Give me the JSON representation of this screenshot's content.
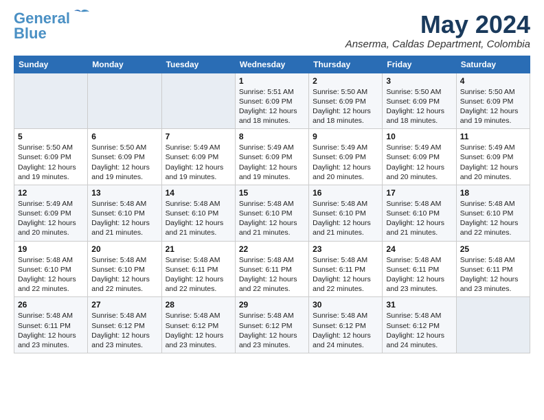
{
  "header": {
    "logo_line1": "General",
    "logo_line2": "Blue",
    "month_year": "May 2024",
    "location": "Anserma, Caldas Department, Colombia"
  },
  "weekdays": [
    "Sunday",
    "Monday",
    "Tuesday",
    "Wednesday",
    "Thursday",
    "Friday",
    "Saturday"
  ],
  "weeks": [
    [
      {
        "day": "",
        "info": ""
      },
      {
        "day": "",
        "info": ""
      },
      {
        "day": "",
        "info": ""
      },
      {
        "day": "1",
        "info": "Sunrise: 5:51 AM\nSunset: 6:09 PM\nDaylight: 12 hours\nand 18 minutes."
      },
      {
        "day": "2",
        "info": "Sunrise: 5:50 AM\nSunset: 6:09 PM\nDaylight: 12 hours\nand 18 minutes."
      },
      {
        "day": "3",
        "info": "Sunrise: 5:50 AM\nSunset: 6:09 PM\nDaylight: 12 hours\nand 18 minutes."
      },
      {
        "day": "4",
        "info": "Sunrise: 5:50 AM\nSunset: 6:09 PM\nDaylight: 12 hours\nand 19 minutes."
      }
    ],
    [
      {
        "day": "5",
        "info": "Sunrise: 5:50 AM\nSunset: 6:09 PM\nDaylight: 12 hours\nand 19 minutes."
      },
      {
        "day": "6",
        "info": "Sunrise: 5:50 AM\nSunset: 6:09 PM\nDaylight: 12 hours\nand 19 minutes."
      },
      {
        "day": "7",
        "info": "Sunrise: 5:49 AM\nSunset: 6:09 PM\nDaylight: 12 hours\nand 19 minutes."
      },
      {
        "day": "8",
        "info": "Sunrise: 5:49 AM\nSunset: 6:09 PM\nDaylight: 12 hours\nand 19 minutes."
      },
      {
        "day": "9",
        "info": "Sunrise: 5:49 AM\nSunset: 6:09 PM\nDaylight: 12 hours\nand 20 minutes."
      },
      {
        "day": "10",
        "info": "Sunrise: 5:49 AM\nSunset: 6:09 PM\nDaylight: 12 hours\nand 20 minutes."
      },
      {
        "day": "11",
        "info": "Sunrise: 5:49 AM\nSunset: 6:09 PM\nDaylight: 12 hours\nand 20 minutes."
      }
    ],
    [
      {
        "day": "12",
        "info": "Sunrise: 5:49 AM\nSunset: 6:09 PM\nDaylight: 12 hours\nand 20 minutes."
      },
      {
        "day": "13",
        "info": "Sunrise: 5:48 AM\nSunset: 6:10 PM\nDaylight: 12 hours\nand 21 minutes."
      },
      {
        "day": "14",
        "info": "Sunrise: 5:48 AM\nSunset: 6:10 PM\nDaylight: 12 hours\nand 21 minutes."
      },
      {
        "day": "15",
        "info": "Sunrise: 5:48 AM\nSunset: 6:10 PM\nDaylight: 12 hours\nand 21 minutes."
      },
      {
        "day": "16",
        "info": "Sunrise: 5:48 AM\nSunset: 6:10 PM\nDaylight: 12 hours\nand 21 minutes."
      },
      {
        "day": "17",
        "info": "Sunrise: 5:48 AM\nSunset: 6:10 PM\nDaylight: 12 hours\nand 21 minutes."
      },
      {
        "day": "18",
        "info": "Sunrise: 5:48 AM\nSunset: 6:10 PM\nDaylight: 12 hours\nand 22 minutes."
      }
    ],
    [
      {
        "day": "19",
        "info": "Sunrise: 5:48 AM\nSunset: 6:10 PM\nDaylight: 12 hours\nand 22 minutes."
      },
      {
        "day": "20",
        "info": "Sunrise: 5:48 AM\nSunset: 6:10 PM\nDaylight: 12 hours\nand 22 minutes."
      },
      {
        "day": "21",
        "info": "Sunrise: 5:48 AM\nSunset: 6:11 PM\nDaylight: 12 hours\nand 22 minutes."
      },
      {
        "day": "22",
        "info": "Sunrise: 5:48 AM\nSunset: 6:11 PM\nDaylight: 12 hours\nand 22 minutes."
      },
      {
        "day": "23",
        "info": "Sunrise: 5:48 AM\nSunset: 6:11 PM\nDaylight: 12 hours\nand 22 minutes."
      },
      {
        "day": "24",
        "info": "Sunrise: 5:48 AM\nSunset: 6:11 PM\nDaylight: 12 hours\nand 23 minutes."
      },
      {
        "day": "25",
        "info": "Sunrise: 5:48 AM\nSunset: 6:11 PM\nDaylight: 12 hours\nand 23 minutes."
      }
    ],
    [
      {
        "day": "26",
        "info": "Sunrise: 5:48 AM\nSunset: 6:11 PM\nDaylight: 12 hours\nand 23 minutes."
      },
      {
        "day": "27",
        "info": "Sunrise: 5:48 AM\nSunset: 6:12 PM\nDaylight: 12 hours\nand 23 minutes."
      },
      {
        "day": "28",
        "info": "Sunrise: 5:48 AM\nSunset: 6:12 PM\nDaylight: 12 hours\nand 23 minutes."
      },
      {
        "day": "29",
        "info": "Sunrise: 5:48 AM\nSunset: 6:12 PM\nDaylight: 12 hours\nand 23 minutes."
      },
      {
        "day": "30",
        "info": "Sunrise: 5:48 AM\nSunset: 6:12 PM\nDaylight: 12 hours\nand 24 minutes."
      },
      {
        "day": "31",
        "info": "Sunrise: 5:48 AM\nSunset: 6:12 PM\nDaylight: 12 hours\nand 24 minutes."
      },
      {
        "day": "",
        "info": ""
      }
    ]
  ]
}
